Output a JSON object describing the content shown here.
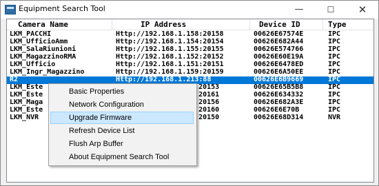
{
  "window": {
    "title": "Equipment Search Tool",
    "minimize": "—",
    "maximize": "☐",
    "close": "✕"
  },
  "columns": [
    "Camera Name",
    "IP Address",
    "Device ID",
    "Type"
  ],
  "rows": [
    {
      "name": "LKM_PACCHI",
      "ip": "Http://192.168.1.158:20158",
      "id": "00626E67574E",
      "type": "IPC"
    },
    {
      "name": "LKM_UfficioAmm",
      "ip": "Http://192.168.1.154:20154",
      "id": "00626E682A44",
      "type": "IPC"
    },
    {
      "name": "LKM_SalaRiunioni",
      "ip": "Http://192.168.1.155:20155",
      "id": "00626E574766",
      "type": "IPC"
    },
    {
      "name": "LKM_MagazzinoRMA",
      "ip": "Http://192.168.1.152:20152",
      "id": "00626E60E19A",
      "type": "IPC"
    },
    {
      "name": "LKM_Ufficio",
      "ip": "Http://192.168.1.151:20151",
      "id": "00626E6478ED",
      "type": "IPC"
    },
    {
      "name": "LKM_Ingr_Magazzino",
      "ip": "Http://192.168.1.159:20159",
      "id": "00626E6A50EE",
      "type": "IPC"
    },
    {
      "name": "R2",
      "ip": "Http://192.168.1.213:88",
      "id": "00626E6B9669",
      "type": "IPC"
    },
    {
      "name": "LKM_Este",
      "ip": ".153:20153",
      "id": "00626E65B5B8",
      "type": "IPC"
    },
    {
      "name": "LKM_Este",
      "ip": ".161:20161",
      "id": "00626E634332",
      "type": "IPC"
    },
    {
      "name": "LKM_Maga",
      "ip": ".156:20156",
      "id": "00626E682A3E",
      "type": "IPC"
    },
    {
      "name": "LKM_Este",
      "ip": ".160:20160",
      "id": "00626E6E70B",
      "type": "IPC"
    },
    {
      "name": "LKM_NVR",
      "ip": ".150:20150",
      "id": "00626E68D314",
      "type": "NVR"
    }
  ],
  "context_menu": {
    "items": [
      "Basic Properties",
      "Network Configuration",
      "Upgrade Firmware",
      "Refresh Device List",
      "Flush Arp Buffer",
      "About Equipment Search Tool"
    ]
  }
}
